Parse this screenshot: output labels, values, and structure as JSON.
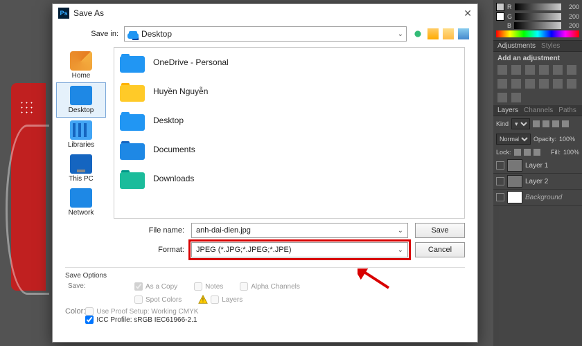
{
  "dialog": {
    "title": "Save As",
    "savein_label": "Save in:",
    "savein_value": "Desktop",
    "places": [
      {
        "label": "Home",
        "icon": "pi-home"
      },
      {
        "label": "Desktop",
        "icon": "pi-desktop",
        "selected": true
      },
      {
        "label": "Libraries",
        "icon": "pi-lib"
      },
      {
        "label": "This PC",
        "icon": "pi-pc"
      },
      {
        "label": "Network",
        "icon": "pi-net"
      }
    ],
    "files": [
      {
        "name": "OneDrive - Personal",
        "color": "fc-blue",
        "overlay": "cloud"
      },
      {
        "name": "Huyền Nguyễn",
        "color": "fc-yellow",
        "overlay": "person"
      },
      {
        "name": "Desktop",
        "color": "fc-blue",
        "overlay": "desk"
      },
      {
        "name": "Documents",
        "color": "fc-darkblue",
        "overlay": "doc"
      },
      {
        "name": "Downloads",
        "color": "fc-teal",
        "overlay": "down"
      }
    ],
    "filename_label": "File name:",
    "filename_value": "anh-dai-dien.jpg",
    "format_label": "Format:",
    "format_value": "JPEG (*.JPG;*.JPEG;*.JPE)",
    "save_btn": "Save",
    "cancel_btn": "Cancel",
    "save_options_title": "Save Options",
    "save_section": "Save:",
    "color_section": "Color:",
    "opts": {
      "as_copy": "As a Copy",
      "notes": "Notes",
      "alpha": "Alpha Channels",
      "spot": "Spot Colors",
      "layers": "Layers",
      "proof": "Use Proof Setup:  Working CMYK",
      "icc": "ICC Profile:  sRGB IEC61966-2.1"
    }
  },
  "right": {
    "rgb": {
      "r": "200",
      "g": "200",
      "b": "200"
    },
    "adjustments_tab": "Adjustments",
    "styles_tab": "Styles",
    "add_adjustment": "Add an adjustment",
    "layers_tab": "Layers",
    "channels_tab": "Channels",
    "paths_tab": "Paths",
    "kind_label": "Kind",
    "blend": "Normal",
    "opacity_label": "Opacity:",
    "opacity_val": "100%",
    "lock_label": "Lock:",
    "fill_label": "Fill:",
    "fill_val": "100%",
    "layers": [
      {
        "name": "Layer 1"
      },
      {
        "name": "Layer 2"
      },
      {
        "name": "Background",
        "italic": true
      }
    ]
  }
}
